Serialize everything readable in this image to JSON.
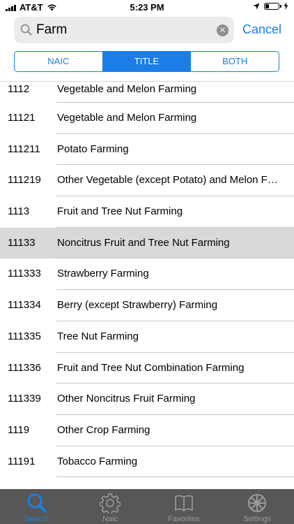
{
  "status_bar": {
    "carrier": "AT&T",
    "time": "5:23 PM"
  },
  "search": {
    "query": "Farm",
    "cancel_label": "Cancel"
  },
  "segments": [
    {
      "label": "NAIC",
      "active": false
    },
    {
      "label": "TITLE",
      "active": true
    },
    {
      "label": "BOTH",
      "active": false
    }
  ],
  "rows": [
    {
      "code": "1112",
      "title": "Vegetable and Melon Farming"
    },
    {
      "code": "11121",
      "title": "Vegetable and Melon Farming"
    },
    {
      "code": "111211",
      "title": "Potato Farming"
    },
    {
      "code": "111219",
      "title": "Other Vegetable (except Potato) and Melon F…"
    },
    {
      "code": "1113",
      "title": "Fruit and Tree Nut Farming"
    },
    {
      "code": "11133",
      "title": "Noncitrus Fruit and Tree Nut Farming",
      "selected": true
    },
    {
      "code": "111333",
      "title": "Strawberry Farming"
    },
    {
      "code": "111334",
      "title": "Berry (except Strawberry) Farming"
    },
    {
      "code": "111335",
      "title": "Tree Nut Farming"
    },
    {
      "code": "111336",
      "title": "Fruit and Tree Nut Combination Farming"
    },
    {
      "code": "111339",
      "title": "Other Noncitrus Fruit Farming"
    },
    {
      "code": "1119",
      "title": "Other Crop Farming"
    },
    {
      "code": "11191",
      "title": "Tobacco Farming"
    }
  ],
  "tabs": [
    {
      "label": "Search",
      "icon": "search-icon",
      "active": true
    },
    {
      "label": "Naic",
      "icon": "gear-icon",
      "active": false
    },
    {
      "label": "Favorites",
      "icon": "book-icon",
      "active": false
    },
    {
      "label": "Settings",
      "icon": "wheel-icon",
      "active": false
    }
  ],
  "colors": {
    "accent": "#1a7ee6",
    "tab_bar": "#575757",
    "selected_row": "#d9d9d9"
  }
}
